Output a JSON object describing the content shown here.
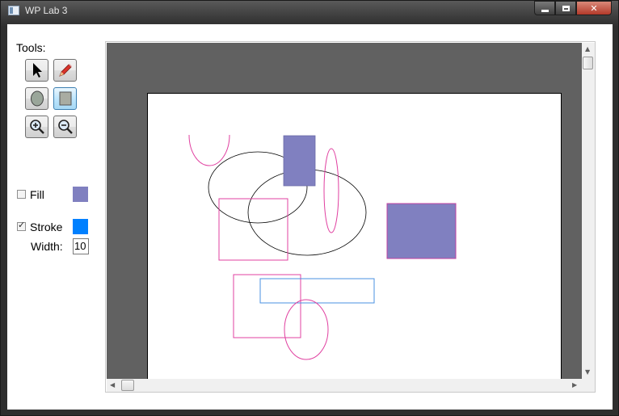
{
  "window": {
    "title": "WP Lab 3",
    "caption_buttons": {
      "minimize": "minimize-icon",
      "maximize": "maximize-icon",
      "close": "✕"
    }
  },
  "tools": {
    "label": "Tools:",
    "buttons": [
      {
        "name": "select",
        "icon": "cursor-arrow-icon",
        "active": false
      },
      {
        "name": "draw",
        "icon": "pencil-icon",
        "active": false
      },
      {
        "name": "ellipse",
        "icon": "ellipse-shape-icon",
        "active": false
      },
      {
        "name": "rectangle",
        "icon": "rectangle-shape-icon",
        "active": true
      },
      {
        "name": "zoom-in",
        "icon": "zoom-in-icon",
        "active": false
      },
      {
        "name": "zoom-out",
        "icon": "zoom-out-icon",
        "active": false
      }
    ]
  },
  "fill": {
    "label": "Fill",
    "checked": false,
    "color": "#8080c0"
  },
  "stroke": {
    "label": "Stroke",
    "checked": true,
    "color": "#0080ff",
    "check_mark": "✓"
  },
  "width": {
    "label": "Width:",
    "value": "10"
  },
  "scroll_arrows": {
    "up": "▲",
    "down": "▼",
    "left": "◀",
    "right": "▶"
  },
  "colors": {
    "pink": "#e040a0",
    "blue": "#4a90e2",
    "black": "#000000",
    "purple_fill": "#8080c0",
    "canvas_bg": "#616161"
  }
}
